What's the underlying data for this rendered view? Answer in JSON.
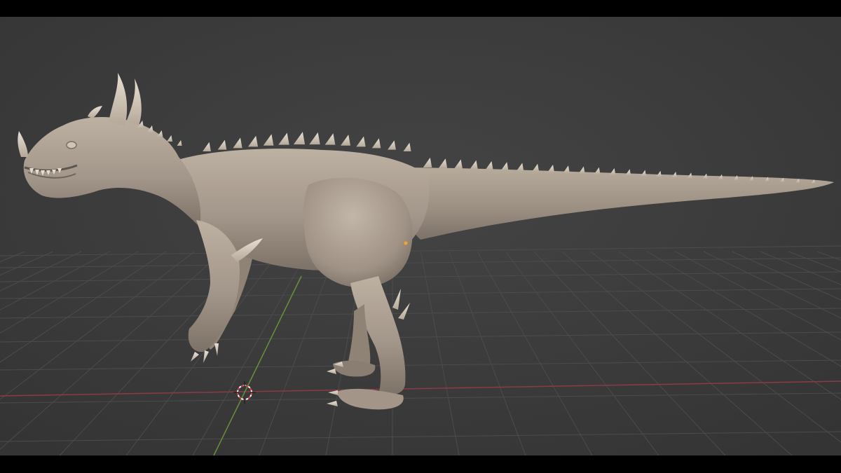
{
  "app": {
    "view": "3d-viewport",
    "mode": "sculpt"
  },
  "viewport": {
    "background_color": "#3d3d3d",
    "grid_color": "#4a4a4a",
    "x_axis_color": "#8a3b47",
    "y_axis_color": "#6a8f3a",
    "model_color": "#a89b8b",
    "origin_marker_color": "#f5a623",
    "cursor_color": "#d84a4a"
  },
  "scene": {
    "object": "dinosaur-sculpt",
    "grid_visible": true,
    "cursor_visible": true
  }
}
